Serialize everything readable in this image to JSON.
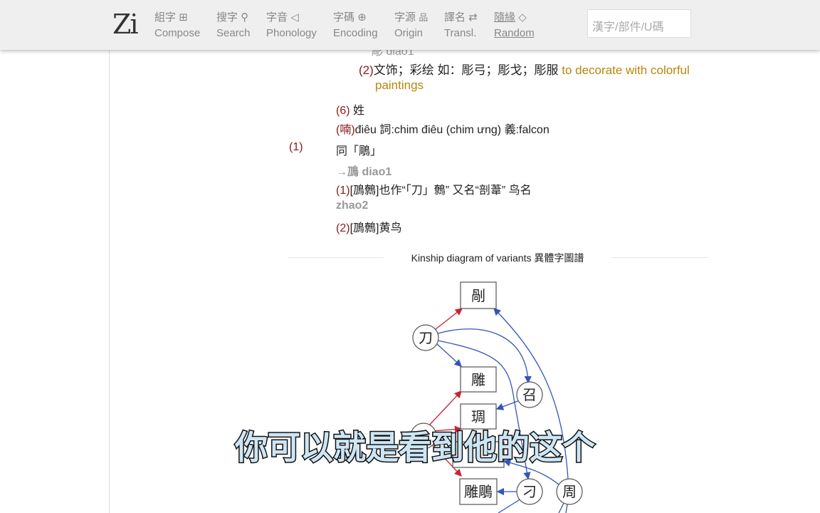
{
  "header": {
    "logo": "Zi",
    "nav": [
      {
        "zh": "組字",
        "icon": "grid-icon",
        "glyph": "⊞",
        "en": "Compose"
      },
      {
        "zh": "搜字",
        "icon": "search-icon",
        "glyph": "⚲",
        "en": "Search"
      },
      {
        "zh": "字音",
        "icon": "speaker-icon",
        "glyph": "◁",
        "en": "Phonology"
      },
      {
        "zh": "字碼",
        "icon": "globe-icon",
        "glyph": "⊕",
        "en": "Encoding"
      },
      {
        "zh": "字源",
        "icon": "hierarchy-icon",
        "glyph": "品",
        "en": "Origin"
      },
      {
        "zh": "譯名",
        "icon": "swap-icon",
        "glyph": "⇄",
        "en": "Transl."
      },
      {
        "zh": "隨緣",
        "icon": "dice-icon",
        "glyph": "◇",
        "en": "Random"
      }
    ],
    "search_placeholder": "漢字/部件/U碼"
  },
  "entry": {
    "cut_line": "彫 diao1",
    "l1_num": "(2)",
    "l1_zh": "文饰；彩绘 如：彫弓；彫戈；彫服",
    "l1_en": "to decorate with colorful",
    "l1_en2": "paintings",
    "l2_num": "(6)",
    "l2_zh": "姓",
    "l3_num": "(喃)",
    "l3_text": "điêu 詞:chim điêu (chim ưng) 義:falcon",
    "l4_num": "(1)",
    "l4_text": "同「鵰」",
    "l5": "→鳭 diao1",
    "l6_num": "(1)",
    "l6_text": "[鳭鷯]也作“「刀」鷯” 又名“剖葦” 鸟名",
    "l7": "zhao2",
    "l8_num": "(2)",
    "l8_text": "[鳭鷯]黄鸟"
  },
  "kinship": {
    "title": "Kinship diagram of variants 異體字圖譜",
    "nodes": [
      "剮",
      "刀",
      "雕",
      "召",
      "琱",
      "刁",
      "周",
      "雕鵰"
    ]
  },
  "subtitle": "你可以就是看到他的这个",
  "colors": {
    "red_edge": "#cc2233",
    "blue_edge": "#3355bb",
    "maroon": "#8b1a1a",
    "gold": "#b8860b"
  }
}
